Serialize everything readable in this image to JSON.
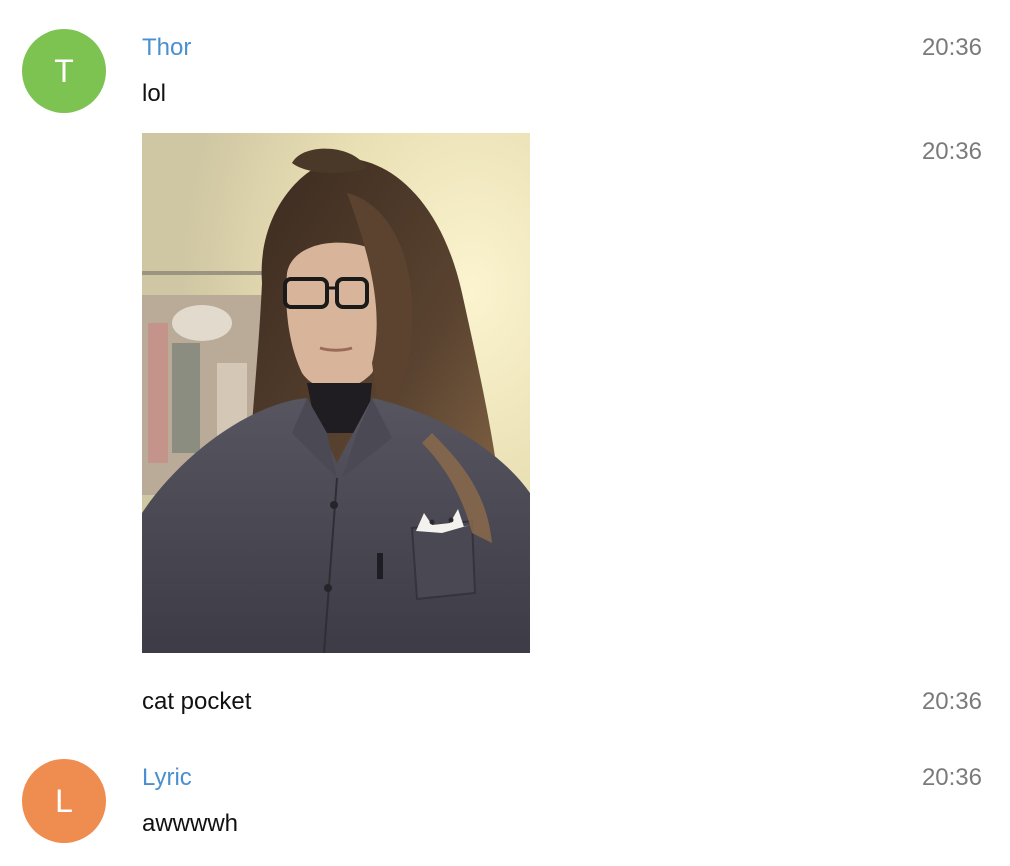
{
  "messages": [
    {
      "sender": "Thor",
      "avatar_initial": "T",
      "avatar_color": "#7cc352",
      "text": "lol",
      "time": "20:36"
    },
    {
      "attachment": "photo",
      "time": "20:36"
    },
    {
      "text": "cat pocket",
      "time": "20:36"
    },
    {
      "sender": "Lyric",
      "avatar_initial": "L",
      "avatar_color": "#ef8c4f",
      "text": "awwwwh",
      "time": "20:36"
    }
  ],
  "colors": {
    "sender_name": "#4a90d0",
    "timestamp": "#7a7a7a",
    "message_text": "#111111"
  }
}
